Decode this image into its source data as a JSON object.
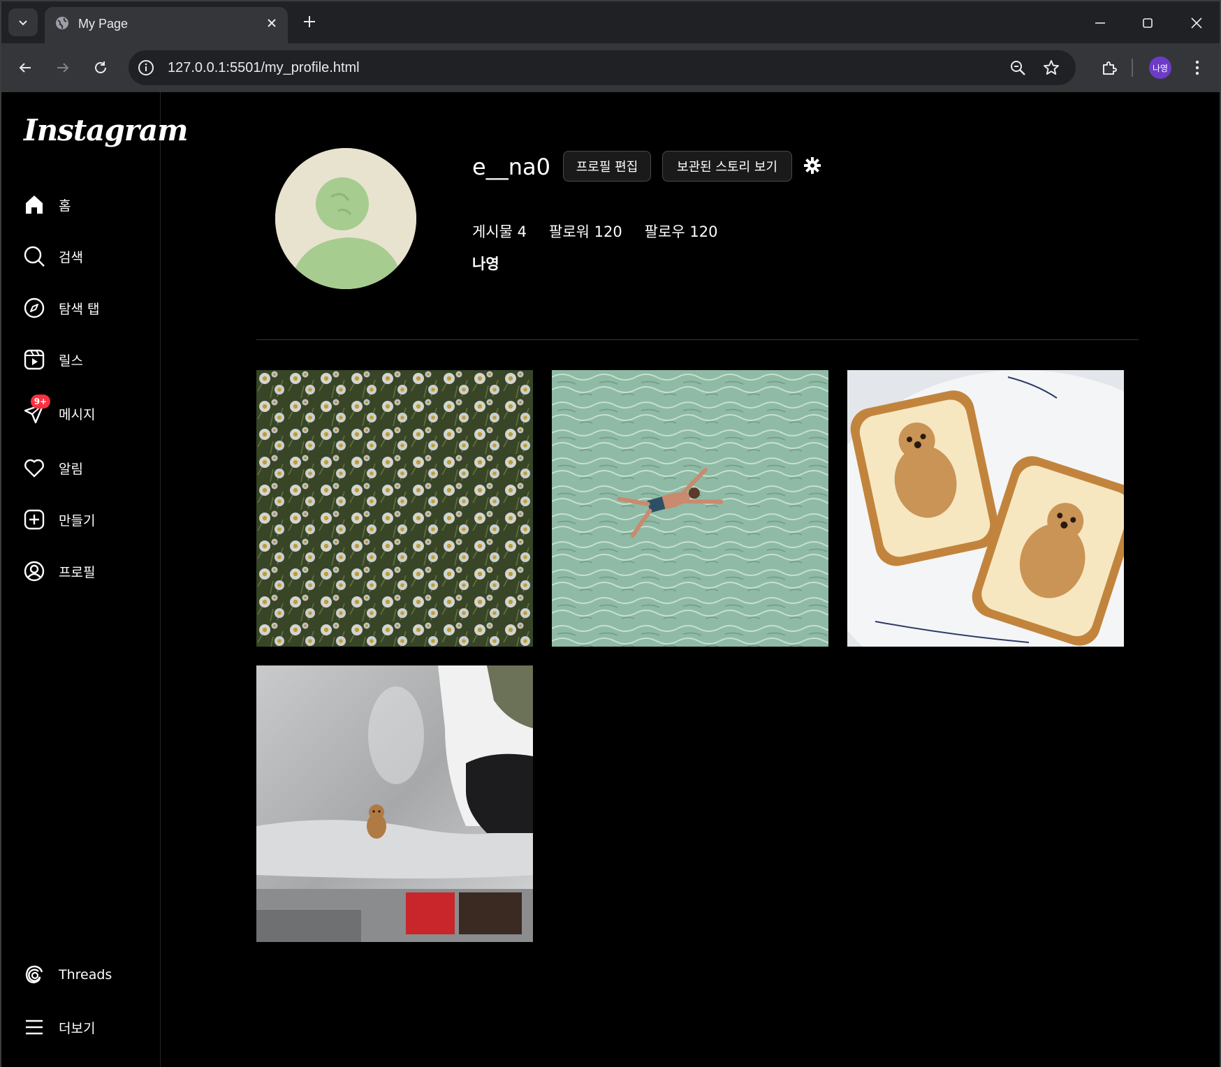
{
  "browser": {
    "tab_title": "My Page",
    "url": "127.0.0.1:5501/my_profile.html",
    "profile_chip": "나영"
  },
  "sidebar": {
    "logo": "Instagram",
    "items": [
      {
        "label": "홈",
        "icon": "home-icon"
      },
      {
        "label": "검색",
        "icon": "search-icon"
      },
      {
        "label": "탐색 탭",
        "icon": "compass-icon"
      },
      {
        "label": "릴스",
        "icon": "reels-icon"
      },
      {
        "label": "메시지",
        "icon": "send-icon",
        "badge": "9+"
      },
      {
        "label": "알림",
        "icon": "heart-icon"
      },
      {
        "label": "만들기",
        "icon": "plus-square-icon"
      },
      {
        "label": "프로필",
        "icon": "profile-icon"
      }
    ],
    "bottom_items": [
      {
        "label": "Threads",
        "icon": "threads-icon"
      },
      {
        "label": "더보기",
        "icon": "menu-icon"
      }
    ]
  },
  "profile": {
    "username": "e__na0",
    "edit_button": "프로필 편집",
    "archive_button": "보관된 스토리 보기",
    "stats": {
      "posts": "게시물 4",
      "followers": "팔로워 120",
      "following": "팔로우 120"
    },
    "full_name": "나영"
  },
  "posts": [
    {
      "subject": "daisy-field"
    },
    {
      "subject": "swimmer-in-sea"
    },
    {
      "subject": "quokka-toast"
    },
    {
      "subject": "quokka-on-subway-seat"
    }
  ],
  "colors": {
    "accent_badge": "#ff3040",
    "background": "#000000",
    "avatar_bg": "#e8e3cf",
    "avatar_fg": "#a7cc90"
  }
}
